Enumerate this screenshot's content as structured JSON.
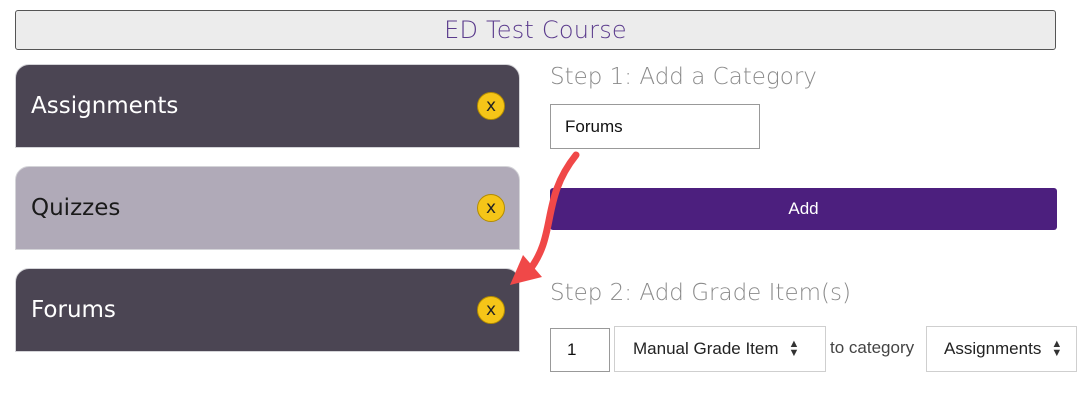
{
  "course": {
    "title": "ED Test Course"
  },
  "categories": [
    {
      "label": "Assignments",
      "remove": "x"
    },
    {
      "label": "Quizzes",
      "remove": "x"
    },
    {
      "label": "Forums",
      "remove": "x"
    }
  ],
  "step1": {
    "title": "Step 1: Add a Category",
    "input_value": "Forums",
    "add_label": "Add"
  },
  "step2": {
    "title": "Step 2: Add Grade Item(s)",
    "quantity": "1",
    "item_type": "Manual Grade Item",
    "to_category_label": "to category",
    "category_select": "Assignments"
  },
  "colors": {
    "accent": "#4c1f7e",
    "dark_tab": "#4b4553",
    "light_tab": "#b0aab8",
    "badge": "#f5c518",
    "annotation_arrow": "#f04848"
  }
}
